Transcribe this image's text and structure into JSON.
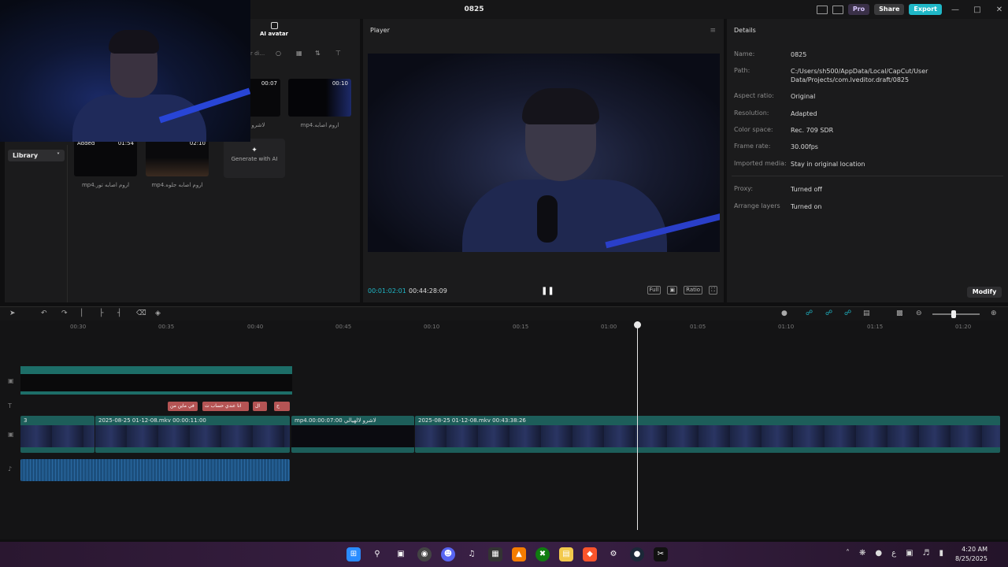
{
  "window": {
    "title": "0825",
    "pro_label": "Pro",
    "share_label": "Share",
    "export_label": "Export"
  },
  "media": {
    "tab_label": "AI avatar",
    "search_placeholder": "r di...",
    "sidebar_library": "Library",
    "items": [
      {
        "duration": "00:07",
        "caption": "لاشرو لالهيالي"
      },
      {
        "duration": "00:10",
        "caption": "mp4.اروم اصابه"
      },
      {
        "duration": "01:54",
        "caption": "mp4.اروم اصابه تور",
        "added": "Added"
      },
      {
        "duration": "02:10",
        "caption": "mp4.اروم اصابه جلوه"
      }
    ],
    "generate_ai": "Generate with AI"
  },
  "player": {
    "title": "Player",
    "timecode_current": "00:01:02:01",
    "timecode_total": "00:44:28:09",
    "ctrl_full": "Full",
    "ctrl_ratio": "Ratio"
  },
  "details": {
    "title": "Details",
    "rows": [
      {
        "key": "Name:",
        "value": "0825"
      },
      {
        "key": "Path:",
        "value": "C:/Users/sh500/AppData/Local/CapCut/User Data/Projects/com.lveditor.draft/0825"
      },
      {
        "key": "Aspect ratio:",
        "value": "Original"
      },
      {
        "key": "Resolution:",
        "value": "Adapted"
      },
      {
        "key": "Color space:",
        "value": "Rec. 709 SDR"
      },
      {
        "key": "Frame rate:",
        "value": "30.00fps"
      },
      {
        "key": "Imported media:",
        "value": "Stay in original location"
      },
      {
        "key": "Proxy:",
        "value": "Turned off"
      },
      {
        "key": "Arrange layers",
        "value": "Turned on"
      }
    ],
    "modify_label": "Modify"
  },
  "ruler": [
    "00:30",
    "00:35",
    "00:40",
    "00:45",
    "00:10",
    "00:15",
    "01:00",
    "01:05",
    "01:10",
    "01:15",
    "01:20"
  ],
  "timeline": {
    "text_clips": [
      "في ماين من",
      "انا عندي حساب ت",
      "ال",
      "ح"
    ],
    "main_clips": [
      {
        "label": "3"
      },
      {
        "label": "2025-08-25 01-12-08.mkv  00:00:11:00"
      },
      {
        "label": "mp4.لاشرو لالهيالي  00:00:07:00"
      },
      {
        "label": "2025-08-25 01-12-08.mkv  00:43:38:26"
      }
    ]
  },
  "taskbar": {
    "time": "4:20 AM",
    "date": "8/25/2025"
  }
}
